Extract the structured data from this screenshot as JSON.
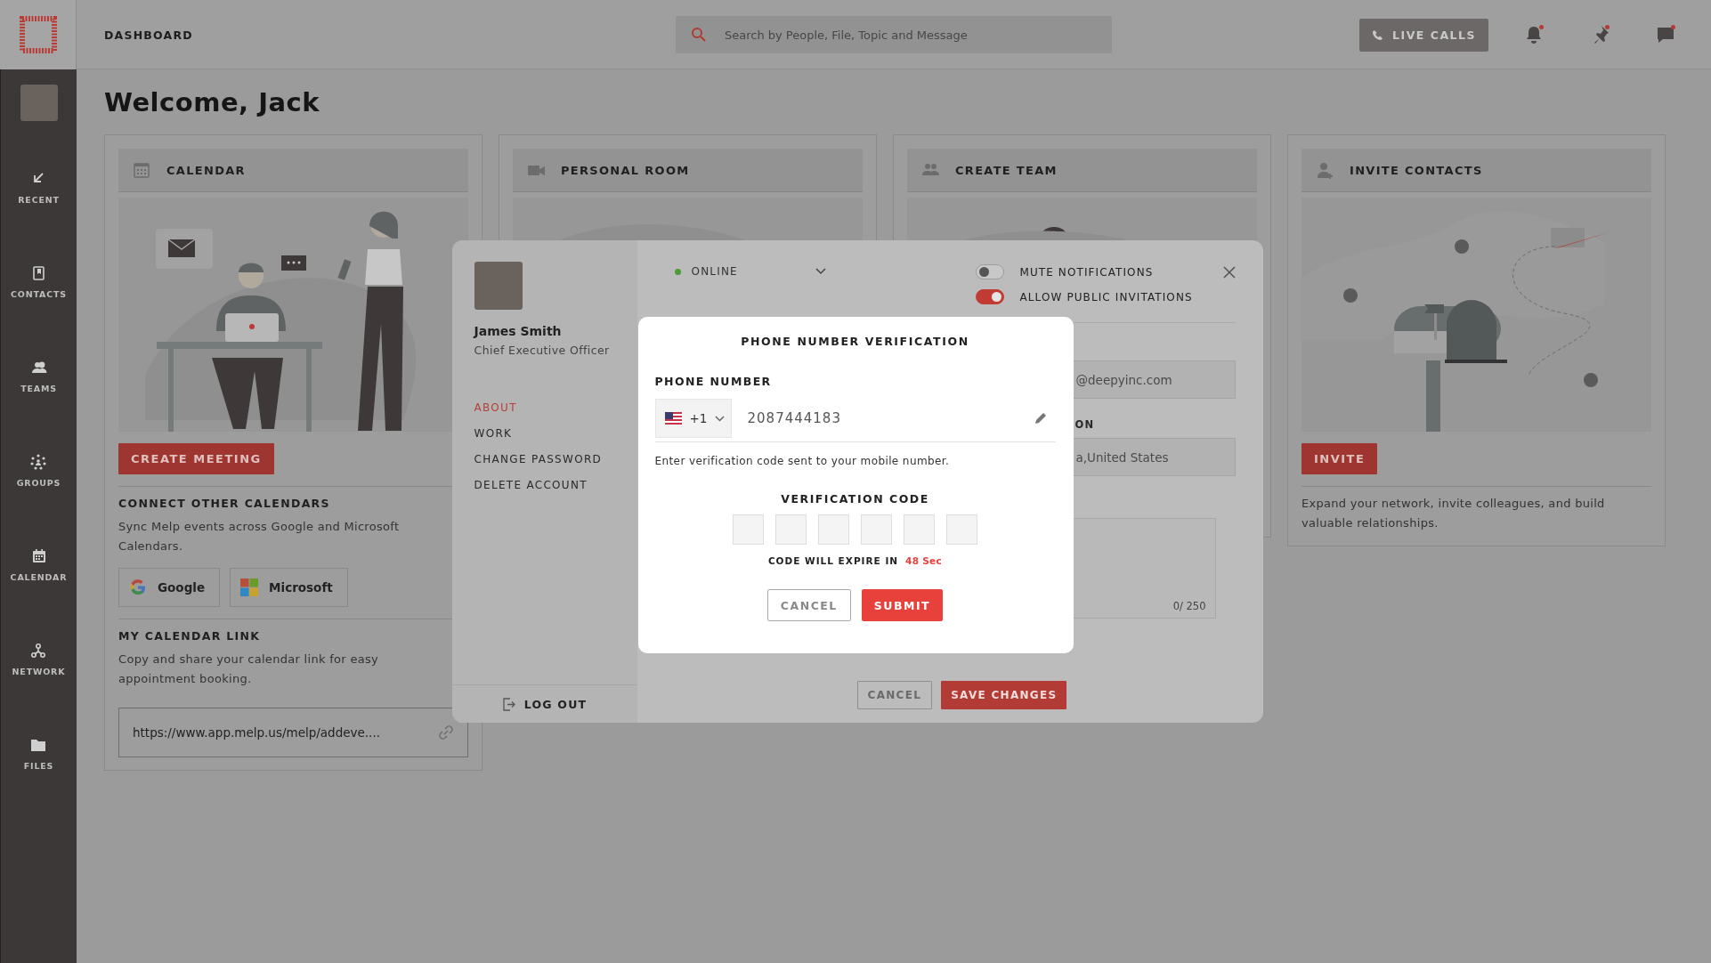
{
  "topbar": {
    "title": "DASHBOARD",
    "search": {
      "placeholder": "Search by People, File, Topic and Message"
    },
    "live_calls": "LIVE CALLS",
    "icons": [
      {
        "kind": "bell",
        "unread": true
      },
      {
        "kind": "pin",
        "unread": true
      },
      {
        "kind": "chat",
        "unread": true
      }
    ]
  },
  "sidebar": {
    "items": [
      {
        "kind": "recent",
        "label": "RECENT"
      },
      {
        "kind": "contacts",
        "label": "CONTACTS"
      },
      {
        "kind": "teams",
        "label": "TEAMS"
      },
      {
        "kind": "groups",
        "label": "GROUPS"
      },
      {
        "kind": "calendar",
        "label": "CALENDAR"
      },
      {
        "kind": "network",
        "label": "NETWORK"
      },
      {
        "kind": "files",
        "label": "FILES"
      }
    ]
  },
  "welcome": "Welcome, Jack",
  "cards": [
    {
      "kind": "calendar",
      "title": "CALENDAR",
      "action": "CREATE MEETING",
      "sections": [
        {
          "heading": "CONNECT OTHER CALENDARS",
          "text": "Sync Melp events across Google and Microsoft Calendars.",
          "providers": [
            {
              "kind": "google",
              "label": "Google"
            },
            {
              "kind": "microsoft",
              "label": "Microsoft"
            }
          ]
        },
        {
          "heading": "MY CALENDAR LINK",
          "text": "Copy and share your calendar link for easy appointment booking.",
          "link": "https://www.app.melp.us/melp/addeve...."
        }
      ]
    },
    {
      "kind": "personal_room",
      "title": "PERSONAL ROOM"
    },
    {
      "kind": "create_team",
      "title": "CREATE TEAM"
    },
    {
      "kind": "invite",
      "title": "INVITE CONTACTS",
      "action": "INVITE",
      "text": "Expand your network, invite colleagues, and build valuable relationships."
    }
  ],
  "profile": {
    "name": "James Smith",
    "role": "Chief Executive Officer",
    "menu": [
      {
        "label": "ABOUT",
        "selected": true
      },
      {
        "label": "WORK",
        "selected": false
      },
      {
        "label": "CHANGE PASSWORD",
        "selected": false
      },
      {
        "label": "DELETE ACCOUNT",
        "selected": false
      }
    ],
    "log_out": "LOG OUT",
    "status": "ONLINE",
    "toggles": [
      {
        "label": "MUTE NOTIFICATIONS",
        "on": false
      },
      {
        "label": "ALLOW PUBLIC INVITATIONS",
        "on": true
      }
    ],
    "fields": [
      {
        "value": "@deepyinc.com"
      },
      {
        "label": "ON",
        "value": "a,United States"
      }
    ],
    "bio_counter": "0/ 250",
    "cancel": "CANCEL",
    "save": "SAVE CHANGES"
  },
  "verification": {
    "title": "PHONE NUMBER VERIFICATION",
    "phone_label": "PHONE NUMBER",
    "country_code": "+1",
    "phone": "2087444183",
    "hint": "Enter verification code sent to your mobile number.",
    "code_label": "VERIFICATION CODE",
    "code_boxes": [
      {
        "focused": false
      },
      {
        "focused": false
      },
      {
        "focused": false
      },
      {
        "focused": false
      },
      {
        "focused": false
      },
      {
        "focused": false
      }
    ],
    "expiry_label": "CODE WILL EXPIRE IN",
    "expiry_time": "48 Sec",
    "cancel": "CANCEL",
    "submit": "SUBMIT"
  }
}
